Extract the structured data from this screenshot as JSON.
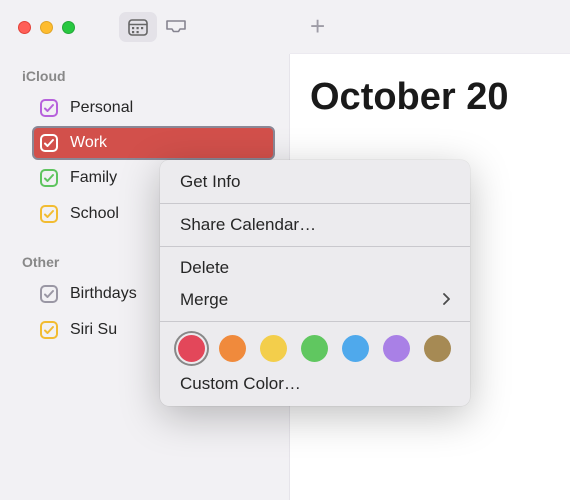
{
  "header": {
    "month_title": "October 20"
  },
  "sidebar": {
    "sections": [
      {
        "title": "iCloud",
        "items": [
          {
            "label": "Personal",
            "color": "#b762dc",
            "checked": true,
            "selected": false
          },
          {
            "label": "Work",
            "color": "#d2504b",
            "checked": true,
            "selected": true
          },
          {
            "label": "Family",
            "color": "#5fc45f",
            "checked": true,
            "selected": false
          },
          {
            "label": "School",
            "color": "#f2bc32",
            "checked": true,
            "selected": false
          }
        ]
      },
      {
        "title": "Other",
        "items": [
          {
            "label": "Birthdays",
            "color": "#9a97a4",
            "checked": true,
            "selected": false
          },
          {
            "label": "Siri Su",
            "color": "#f2bc32",
            "checked": true,
            "selected": false
          }
        ]
      }
    ]
  },
  "context_menu": {
    "get_info": "Get Info",
    "share": "Share Calendar…",
    "delete": "Delete",
    "merge": "Merge",
    "custom_color": "Custom Color…",
    "colors": [
      {
        "hex": "#e3475a",
        "selected": true
      },
      {
        "hex": "#f08a3c",
        "selected": false
      },
      {
        "hex": "#f3ce4b",
        "selected": false
      },
      {
        "hex": "#60c760",
        "selected": false
      },
      {
        "hex": "#4fa9ec",
        "selected": false
      },
      {
        "hex": "#a980e6",
        "selected": false
      },
      {
        "hex": "#a68a54",
        "selected": false
      }
    ]
  }
}
